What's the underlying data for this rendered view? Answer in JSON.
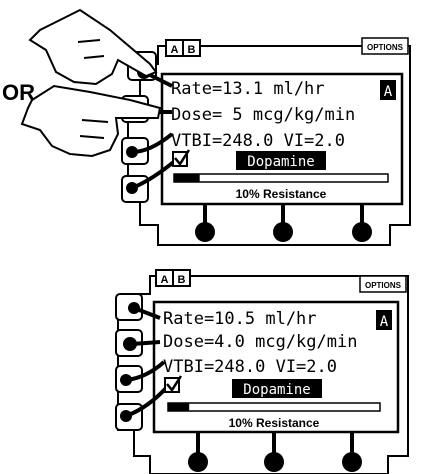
{
  "or_label": "OR",
  "colors": {
    "ink": "#000000",
    "paper": "#ffffff"
  },
  "screens": [
    {
      "tab_a": "A",
      "tab_b": "B",
      "options_label": "OPTIONS",
      "rate_line": "Rate=13.1 ml/hr",
      "dose_line": "Dose= 5 mcg/kg/min",
      "vtbi_line": "VTBI=248.0  VI=2.0",
      "channel_badge": "A",
      "drug_name": "Dopamine",
      "resistance_label": "10% Resistance",
      "progress_fraction": 0.12
    },
    {
      "tab_a": "A",
      "tab_b": "B",
      "options_label": "OPTIONS",
      "rate_line": "Rate=10.5 ml/hr",
      "dose_line": "Dose=4.0 mcg/kg/min",
      "vtbi_line": "VTBI=248.0  VI=2.0",
      "channel_badge": "A",
      "drug_name": "Dopamine",
      "resistance_label": "10% Resistance",
      "progress_fraction": 0.1
    }
  ]
}
